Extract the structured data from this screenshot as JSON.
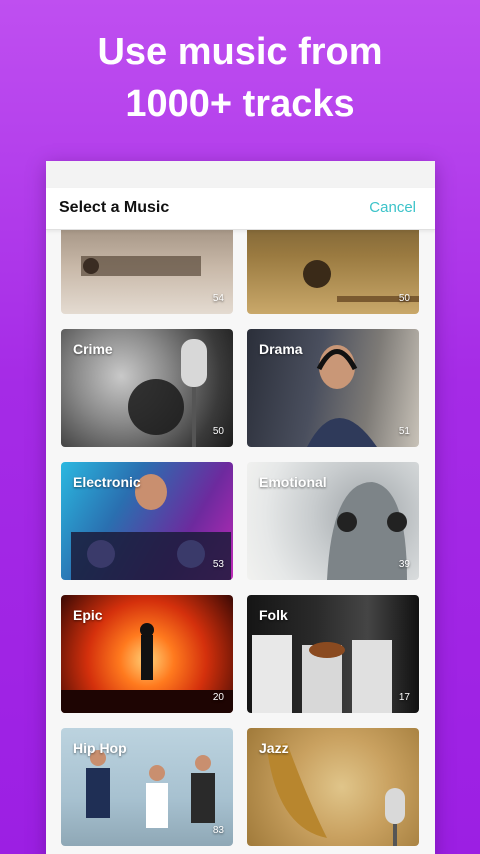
{
  "promo": {
    "line1": "Use music from",
    "line2": "1000+ tracks"
  },
  "dialog": {
    "title": "Select a Music",
    "cancel_label": "Cancel"
  },
  "categories": [
    {
      "label": "",
      "count": "54"
    },
    {
      "label": "",
      "count": "50"
    },
    {
      "label": "Crime",
      "count": "50"
    },
    {
      "label": "Drama",
      "count": "51"
    },
    {
      "label": "Electronic",
      "count": "53"
    },
    {
      "label": "Emotional",
      "count": "39"
    },
    {
      "label": "Epic",
      "count": "20"
    },
    {
      "label": "Folk",
      "count": "17"
    },
    {
      "label": "Hip Hop",
      "count": "83"
    },
    {
      "label": "Jazz",
      "count": ""
    }
  ]
}
